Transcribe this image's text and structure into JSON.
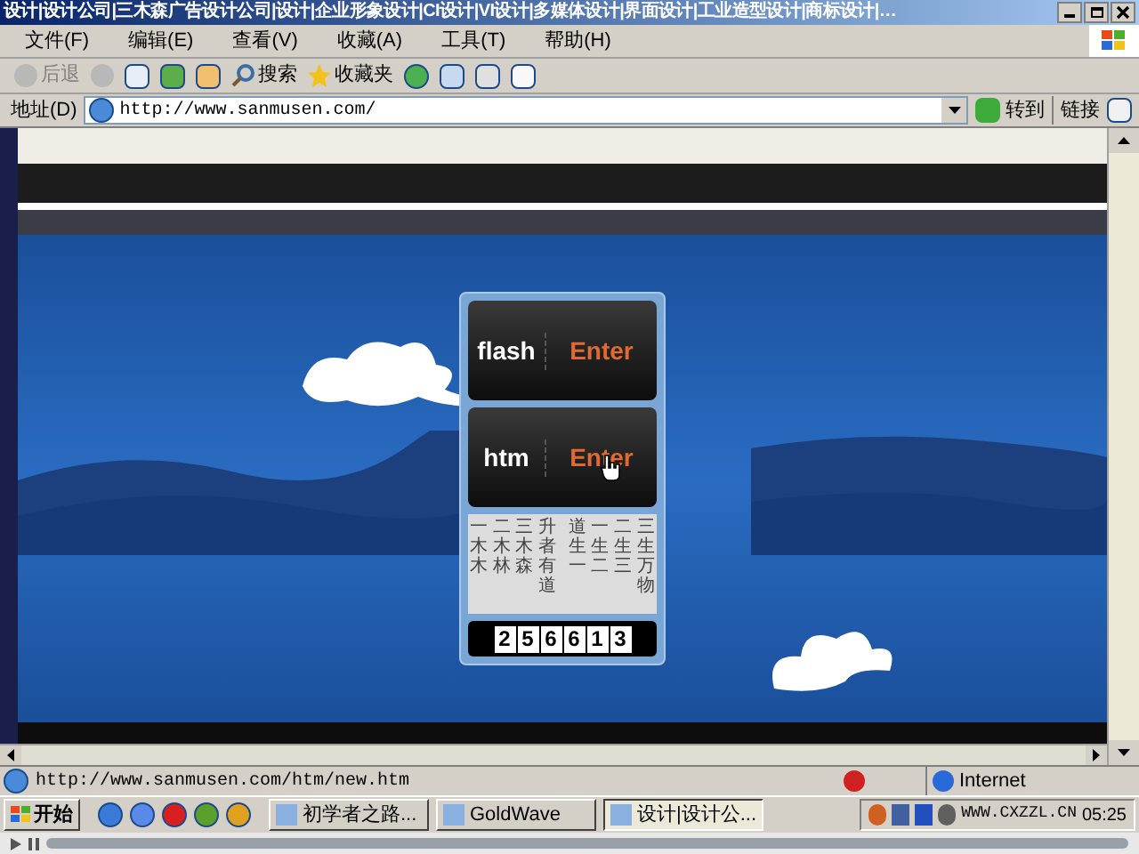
{
  "window": {
    "title": "设计|设计公司|三木森广告设计公司|设计|企业形象设计|CI设计|VI设计|多媒体设计|界面设计|工业造型设计|商标设计|…"
  },
  "menu": [
    "文件(F)",
    "编辑(E)",
    "查看(V)",
    "收藏(A)",
    "工具(T)",
    "帮助(H)"
  ],
  "toolbar": {
    "back": "后退",
    "search": "搜索",
    "favorites": "收藏夹"
  },
  "address_bar": {
    "label": "地址(D)",
    "value": "http://www.sanmusen.com/",
    "go": "转到",
    "links": "链接"
  },
  "page": {
    "entries": [
      {
        "label": "flash",
        "action": "Enter"
      },
      {
        "label": "htm",
        "action": "Enter"
      }
    ],
    "poem_columns": [
      "一木木",
      "二木林",
      "三木森",
      "升者有道",
      "道生一",
      "一生二",
      "二生三",
      "三生万物"
    ],
    "counter": [
      "2",
      "5",
      "6",
      "6",
      "1",
      "3"
    ]
  },
  "status_bar": {
    "url": "http://www.sanmusen.com/htm/new.htm",
    "zone": "Internet"
  },
  "taskbar": {
    "start": "开始",
    "tasks": [
      {
        "label": "初学者之路...",
        "selected": false
      },
      {
        "label": "GoldWave",
        "selected": false
      },
      {
        "label": "设计|设计公...",
        "selected": true
      }
    ],
    "tray_text": "WWW.CXZZL.CN",
    "clock": "05:25"
  }
}
